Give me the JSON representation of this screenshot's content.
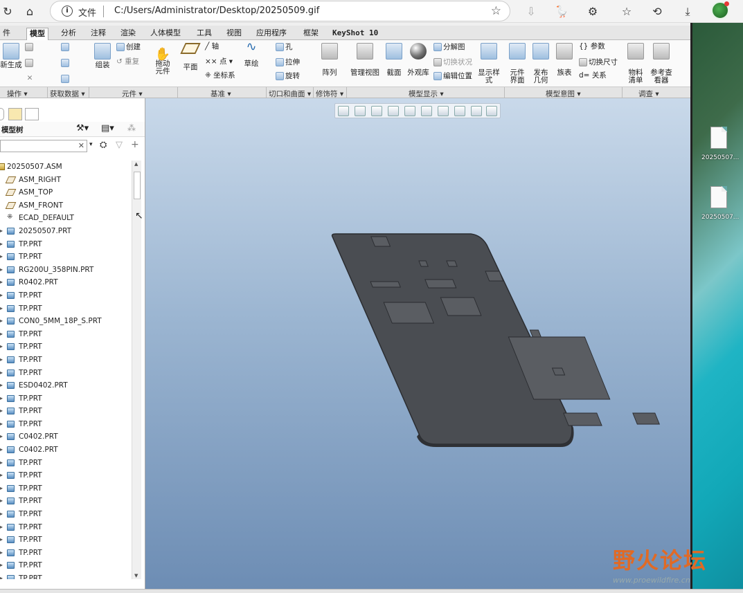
{
  "browser": {
    "file_label": "文件",
    "url": "C:/Users/Administrator/Desktop/20250509.gif"
  },
  "tabs": [
    {
      "label": "件"
    },
    {
      "label": "模型"
    },
    {
      "label": "分析"
    },
    {
      "label": "注释"
    },
    {
      "label": "渲染"
    },
    {
      "label": "人体模型"
    },
    {
      "label": "工具"
    },
    {
      "label": "视图"
    },
    {
      "label": "应用程序"
    },
    {
      "label": "框架"
    },
    {
      "label": "KeyShot 10"
    }
  ],
  "ribbon": {
    "regen": "新生成",
    "assemble": "组装",
    "create": "创建",
    "repeat": "重复",
    "drag": "拖动\n元件",
    "plane": "平面",
    "axis": "轴",
    "point": "点",
    "csys": "坐标系",
    "sketch": "草绘",
    "hole": "孔",
    "extrude": "拉伸",
    "revolve": "旋转",
    "pattern": "阵列",
    "manage_views": "管理视图",
    "section": "截面",
    "appearance": "外观库",
    "exploded": "分解图",
    "toggle_status": "切换状况",
    "edit_position": "编辑位置",
    "display_style": "显示样式",
    "component_interface": "元件界面",
    "publish_geometry": "发布几何",
    "family_table": "族表",
    "params": "参数",
    "toggle_dims": "切换尺寸",
    "relations": "关系",
    "bom": "物料清单",
    "ref_viewer": "参考查看器"
  },
  "groups": [
    {
      "label": "操作"
    },
    {
      "label": "获取数据"
    },
    {
      "label": "元件"
    },
    {
      "label": "基准"
    },
    {
      "label": "切口和曲面"
    },
    {
      "label": "修饰符"
    },
    {
      "label": "模型显示"
    },
    {
      "label": "模型意图"
    },
    {
      "label": "调查"
    }
  ],
  "tree": {
    "title": "模型树",
    "items": [
      {
        "label": "20250507.ASM",
        "kind": "asm"
      },
      {
        "label": "ASM_RIGHT",
        "kind": "plane"
      },
      {
        "label": "ASM_TOP",
        "kind": "plane"
      },
      {
        "label": "ASM_FRONT",
        "kind": "plane"
      },
      {
        "label": "ECAD_DEFAULT",
        "kind": "csys"
      },
      {
        "label": "20250507.PRT",
        "kind": "part"
      },
      {
        "label": "TP.PRT",
        "kind": "part"
      },
      {
        "label": "TP.PRT",
        "kind": "part"
      },
      {
        "label": "RG200U_358PIN.PRT",
        "kind": "part"
      },
      {
        "label": "R0402.PRT",
        "kind": "part"
      },
      {
        "label": "TP.PRT",
        "kind": "part"
      },
      {
        "label": "TP.PRT",
        "kind": "part"
      },
      {
        "label": "CON0_5MM_18P_S.PRT",
        "kind": "part"
      },
      {
        "label": "TP.PRT",
        "kind": "part"
      },
      {
        "label": "TP.PRT",
        "kind": "part"
      },
      {
        "label": "TP.PRT",
        "kind": "part"
      },
      {
        "label": "TP.PRT",
        "kind": "part"
      },
      {
        "label": "ESD0402.PRT",
        "kind": "part"
      },
      {
        "label": "TP.PRT",
        "kind": "part"
      },
      {
        "label": "TP.PRT",
        "kind": "part"
      },
      {
        "label": "TP.PRT",
        "kind": "part"
      },
      {
        "label": "C0402.PRT",
        "kind": "part"
      },
      {
        "label": "C0402.PRT",
        "kind": "part"
      },
      {
        "label": "TP.PRT",
        "kind": "part"
      },
      {
        "label": "TP.PRT",
        "kind": "part"
      },
      {
        "label": "TP.PRT",
        "kind": "part"
      },
      {
        "label": "TP.PRT",
        "kind": "part"
      },
      {
        "label": "TP.PRT",
        "kind": "part"
      },
      {
        "label": "TP.PRT",
        "kind": "part"
      },
      {
        "label": "TP.PRT",
        "kind": "part"
      },
      {
        "label": "TP.PRT",
        "kind": "part"
      },
      {
        "label": "TP.PRT",
        "kind": "part"
      },
      {
        "label": "TP.PRT",
        "kind": "part"
      }
    ]
  },
  "desktop": {
    "file1": "20250507...",
    "file2": "20250507..."
  },
  "watermark": {
    "main": "野火论坛",
    "sub": "www.proewildfire.cn"
  }
}
